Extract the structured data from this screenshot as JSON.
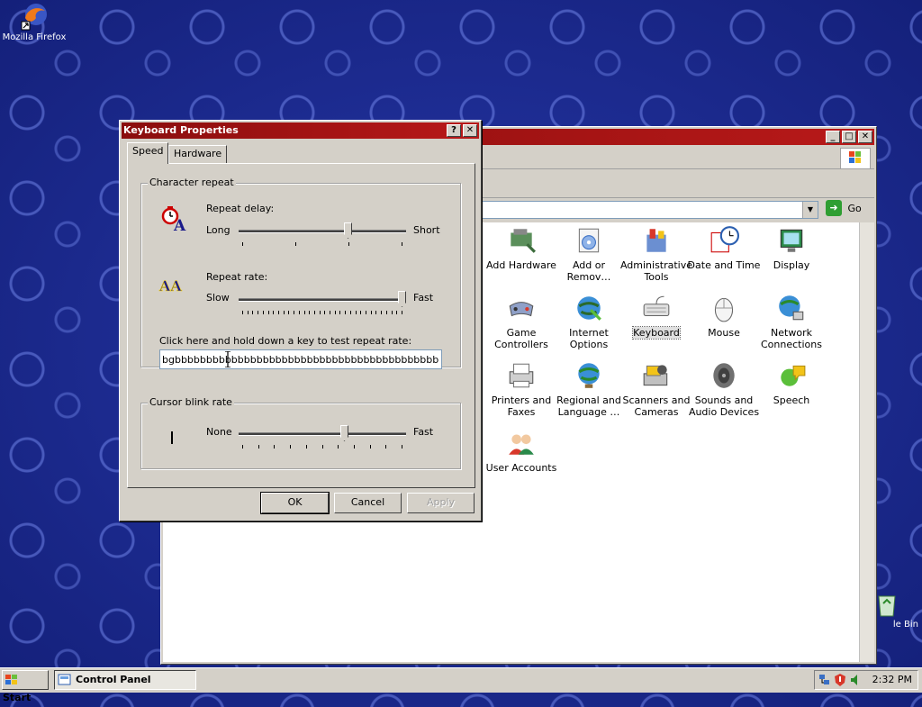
{
  "desktop": {
    "icons": [
      {
        "label": "Mozilla Firefox",
        "icon": "firefox-icon"
      },
      {
        "label": "le Bin",
        "icon": "recycle-bin-icon"
      }
    ]
  },
  "control_panel": {
    "address_go": "Go",
    "items": [
      {
        "label": "Add Hardware",
        "icon": "add-hardware-icon"
      },
      {
        "label": "Add or Remov…",
        "icon": "add-remove-programs-icon"
      },
      {
        "label": "Administrative Tools",
        "icon": "administrative-tools-icon"
      },
      {
        "label": "Date and Time",
        "icon": "date-time-icon"
      },
      {
        "label": "Display",
        "icon": "display-icon"
      },
      {
        "label": "Game Controllers",
        "icon": "game-controllers-icon"
      },
      {
        "label": "Internet Options",
        "icon": "internet-options-icon"
      },
      {
        "label": "Keyboard",
        "icon": "keyboard-icon"
      },
      {
        "label": "Mouse",
        "icon": "mouse-icon"
      },
      {
        "label": "Network Connections",
        "icon": "network-connections-icon"
      },
      {
        "label": "Printers and Faxes",
        "icon": "printers-faxes-icon"
      },
      {
        "label": "Regional and Language …",
        "icon": "regional-language-icon"
      },
      {
        "label": "Scanners and Cameras",
        "icon": "scanners-cameras-icon"
      },
      {
        "label": "Sounds and Audio Devices",
        "icon": "sounds-audio-icon"
      },
      {
        "label": "Speech",
        "icon": "speech-icon"
      },
      {
        "label": "User Accounts",
        "icon": "user-accounts-icon"
      }
    ],
    "partial_label": "s"
  },
  "keyboard_dialog": {
    "title": "Keyboard Properties",
    "help": "?",
    "close": "✕",
    "tabs": [
      "Speed",
      "Hardware"
    ],
    "active_tab": "Speed",
    "character_repeat": {
      "title": "Character repeat",
      "repeat_delay": {
        "label": "Repeat delay:",
        "min": "Long",
        "max": "Short",
        "value": 0.66
      },
      "repeat_rate": {
        "label": "Repeat rate:",
        "min": "Slow",
        "max": "Fast",
        "value": 1.0
      },
      "test_label": "Click here and hold down a key to test repeat rate:",
      "test_value": "bgbbbbbbbbbbbbbbbbbbbbbbbbbbbbbbbbbbbbbbbbbbbbbb"
    },
    "cursor_blink": {
      "title": "Cursor blink rate",
      "min": "None",
      "max": "Fast",
      "value": 0.64
    },
    "buttons": {
      "ok": "OK",
      "cancel": "Cancel",
      "apply": "Apply"
    }
  },
  "taskbar": {
    "start": "Start",
    "task": "Control Panel",
    "clock": "2:32 PM"
  }
}
